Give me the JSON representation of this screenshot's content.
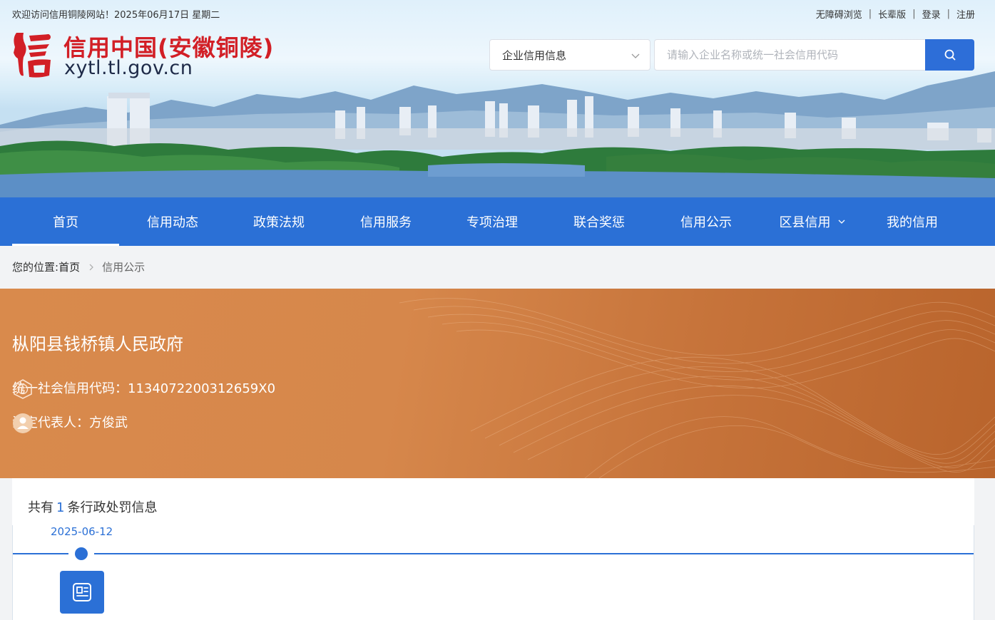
{
  "topbar": {
    "welcome": "欢迎访问信用铜陵网站！2025年06月17日 星期二",
    "links": [
      "无障碍浏览",
      "长辈版",
      "登录",
      "注册"
    ]
  },
  "logo": {
    "mark_char": "信",
    "title_cn": "信用中国(安徽铜陵)",
    "domain": "xytl.tl.gov.cn"
  },
  "search": {
    "category": "企业信用信息",
    "placeholder": "请输入企业名称或统一社会信用代码"
  },
  "nav": {
    "items": [
      "首页",
      "信用动态",
      "政策法规",
      "信用服务",
      "专项治理",
      "联合奖惩",
      "信用公示",
      "区县信用",
      "我的信用"
    ],
    "active": "首页"
  },
  "breadcrumb": {
    "label": "您的位置:",
    "home": "首页",
    "current": "信用公示"
  },
  "org": {
    "name": "枞阳县钱桥镇人民政府",
    "credit_code_text": "统一社会信用代码：1134072200312659X0",
    "legal_rep_text": "法定代表人：方俊武"
  },
  "records": {
    "prefix": "共有",
    "count": "1",
    "suffix": "条行政处罚信息",
    "items": [
      {
        "date": "2025-06-12"
      }
    ]
  },
  "colors": {
    "primary": "#2b70d6",
    "logo_red": "#d21f26",
    "hero_orange": "#d6874b"
  }
}
